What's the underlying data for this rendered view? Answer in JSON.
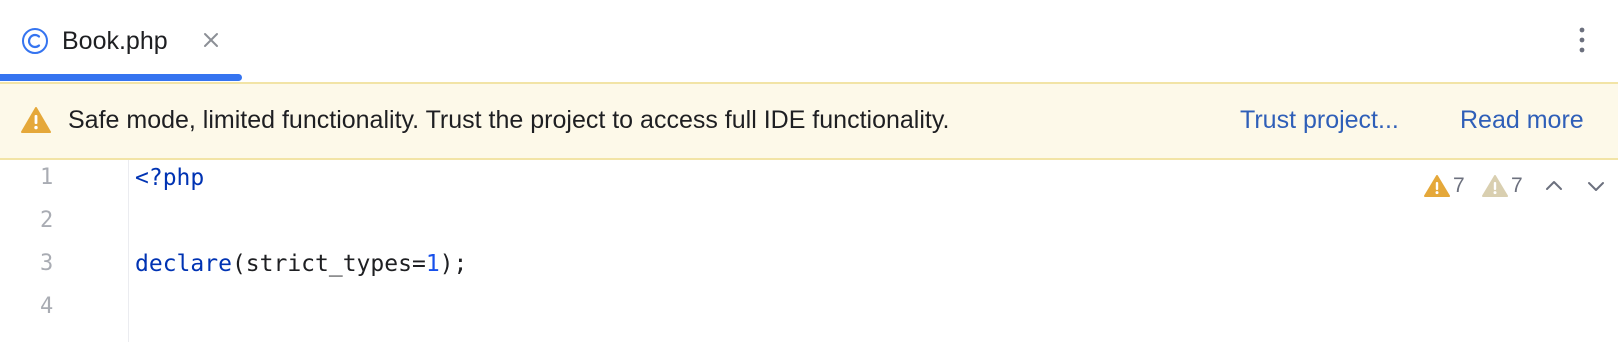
{
  "tab": {
    "filename": "Book.php",
    "icon": "php-class-icon"
  },
  "banner": {
    "message": "Safe mode, limited functionality. Trust the project to access full IDE functionality.",
    "trust_link": "Trust project...",
    "read_more_link": "Read more",
    "icon": "warning-icon"
  },
  "editor": {
    "line_numbers": [
      "1",
      "2",
      "3",
      "4"
    ],
    "lines": {
      "l1_open_tag": "<?php",
      "l3_keyword": "declare",
      "l3_open": "(strict_types=",
      "l3_number": "1",
      "l3_close": ");"
    }
  },
  "inspections": {
    "warnings": "7",
    "weak_warnings": "7"
  },
  "colors": {
    "accent": "#3574f0",
    "banner_bg": "#fdf9e9",
    "link": "#2f5fb8",
    "keyword": "#0033b3",
    "warning": "#e5a83a"
  }
}
